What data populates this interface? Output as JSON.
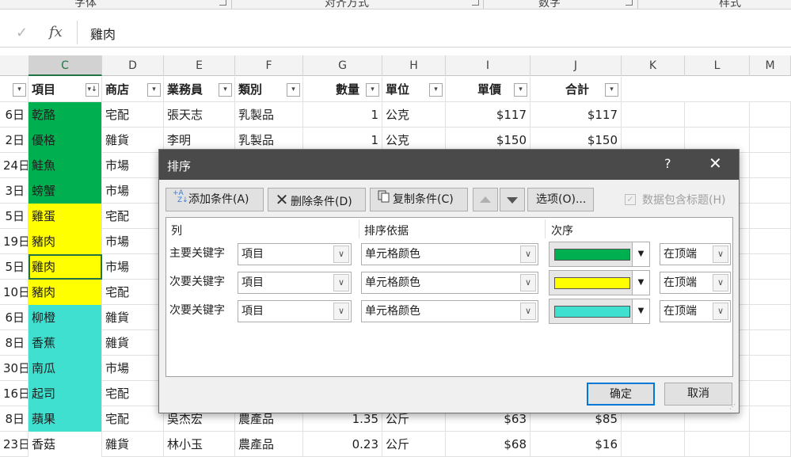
{
  "ribbon": {
    "groups": [
      "字体",
      "对齐方式",
      "数字",
      "样式"
    ]
  },
  "formula_bar": {
    "cancel_icon": "✓",
    "fx_label": "fx",
    "value": "雞肉"
  },
  "columns": [
    "C",
    "D",
    "E",
    "F",
    "G",
    "H",
    "I",
    "J",
    "K",
    "L",
    "M"
  ],
  "table": {
    "headers": {
      "item": "項目",
      "store": "商店",
      "salesperson": "業務員",
      "category": "類別",
      "qty": "數量",
      "unit": "單位",
      "price": "單價",
      "total": "合計"
    },
    "rows": [
      {
        "date": "6日",
        "item": "乾酪",
        "store": "宅配",
        "salesperson": "張天志",
        "category": "乳製品",
        "qty": "1",
        "unit": "公克",
        "price": "$117",
        "total": "$117",
        "color": "#00b050"
      },
      {
        "date": "2日",
        "item": "優格",
        "store": "雜貨",
        "salesperson": "李明",
        "category": "乳製品",
        "qty": "1",
        "unit": "公克",
        "price": "$150",
        "total": "$150",
        "color": "#00b050"
      },
      {
        "date": "24日",
        "item": "鮭魚",
        "store": "市場",
        "salesperson": "",
        "category": "",
        "qty": "",
        "unit": "",
        "price": "",
        "total": "",
        "color": "#00b050"
      },
      {
        "date": "3日",
        "item": "螃蟹",
        "store": "市場",
        "salesperson": "",
        "category": "",
        "qty": "",
        "unit": "",
        "price": "",
        "total": "",
        "color": "#00b050"
      },
      {
        "date": "5日",
        "item": "雞蛋",
        "store": "宅配",
        "salesperson": "",
        "category": "",
        "qty": "",
        "unit": "",
        "price": "",
        "total": "",
        "color": "#ffff00"
      },
      {
        "date": "19日",
        "item": "豬肉",
        "store": "市場",
        "salesperson": "",
        "category": "",
        "qty": "",
        "unit": "",
        "price": "",
        "total": "",
        "color": "#ffff00"
      },
      {
        "date": "5日",
        "item": "雞肉",
        "store": "市場",
        "salesperson": "",
        "category": "",
        "qty": "",
        "unit": "",
        "price": "",
        "total": "",
        "color": "#ffff00"
      },
      {
        "date": "10日",
        "item": "豬肉",
        "store": "宅配",
        "salesperson": "",
        "category": "",
        "qty": "",
        "unit": "",
        "price": "",
        "total": "",
        "color": "#ffff00"
      },
      {
        "date": "6日",
        "item": "柳橙",
        "store": "雜貨",
        "salesperson": "",
        "category": "",
        "qty": "",
        "unit": "",
        "price": "",
        "total": "",
        "color": "#40e0d0"
      },
      {
        "date": "8日",
        "item": "香蕉",
        "store": "雜貨",
        "salesperson": "",
        "category": "",
        "qty": "",
        "unit": "",
        "price": "",
        "total": "",
        "color": "#40e0d0"
      },
      {
        "date": "30日",
        "item": "南瓜",
        "store": "市場",
        "salesperson": "",
        "category": "",
        "qty": "",
        "unit": "",
        "price": "",
        "total": "",
        "color": "#40e0d0"
      },
      {
        "date": "16日",
        "item": "起司",
        "store": "宅配",
        "salesperson": "",
        "category": "",
        "qty": "",
        "unit": "",
        "price": "",
        "total": "",
        "color": "#40e0d0"
      },
      {
        "date": "8日",
        "item": "蘋果",
        "store": "宅配",
        "salesperson": "吳杰宏",
        "category": "農產品",
        "qty": "1.35",
        "unit": "公斤",
        "price": "$63",
        "total": "$85",
        "color": "#40e0d0"
      },
      {
        "date": "23日",
        "item": "香菇",
        "store": "雜貨",
        "salesperson": "林小玉",
        "category": "農產品",
        "qty": "0.23",
        "unit": "公斤",
        "price": "$68",
        "total": "$16",
        "color": "#ffffff"
      }
    ]
  },
  "dialog": {
    "title": "排序",
    "help": "?",
    "close": "✕",
    "toolbar": {
      "add": "添加条件(A)",
      "delete": "删除条件(D)",
      "copy": "复制条件(C)",
      "options": "选项(O)...",
      "has_header": "数据包含标题(H)"
    },
    "columns_header": {
      "col": "列",
      "sort_on": "排序依据",
      "order": "次序"
    },
    "levels": [
      {
        "label": "主要关键字",
        "column": "項目",
        "sort_on": "单元格颜色",
        "color": "#00b050",
        "position": "在顶端"
      },
      {
        "label": "次要关键字",
        "column": "項目",
        "sort_on": "单元格颜色",
        "color": "#ffff00",
        "position": "在顶端"
      },
      {
        "label": "次要关键字",
        "column": "項目",
        "sort_on": "单元格颜色",
        "color": "#40e0d0",
        "position": "在顶端"
      }
    ],
    "ok": "确定",
    "cancel": "取消"
  }
}
